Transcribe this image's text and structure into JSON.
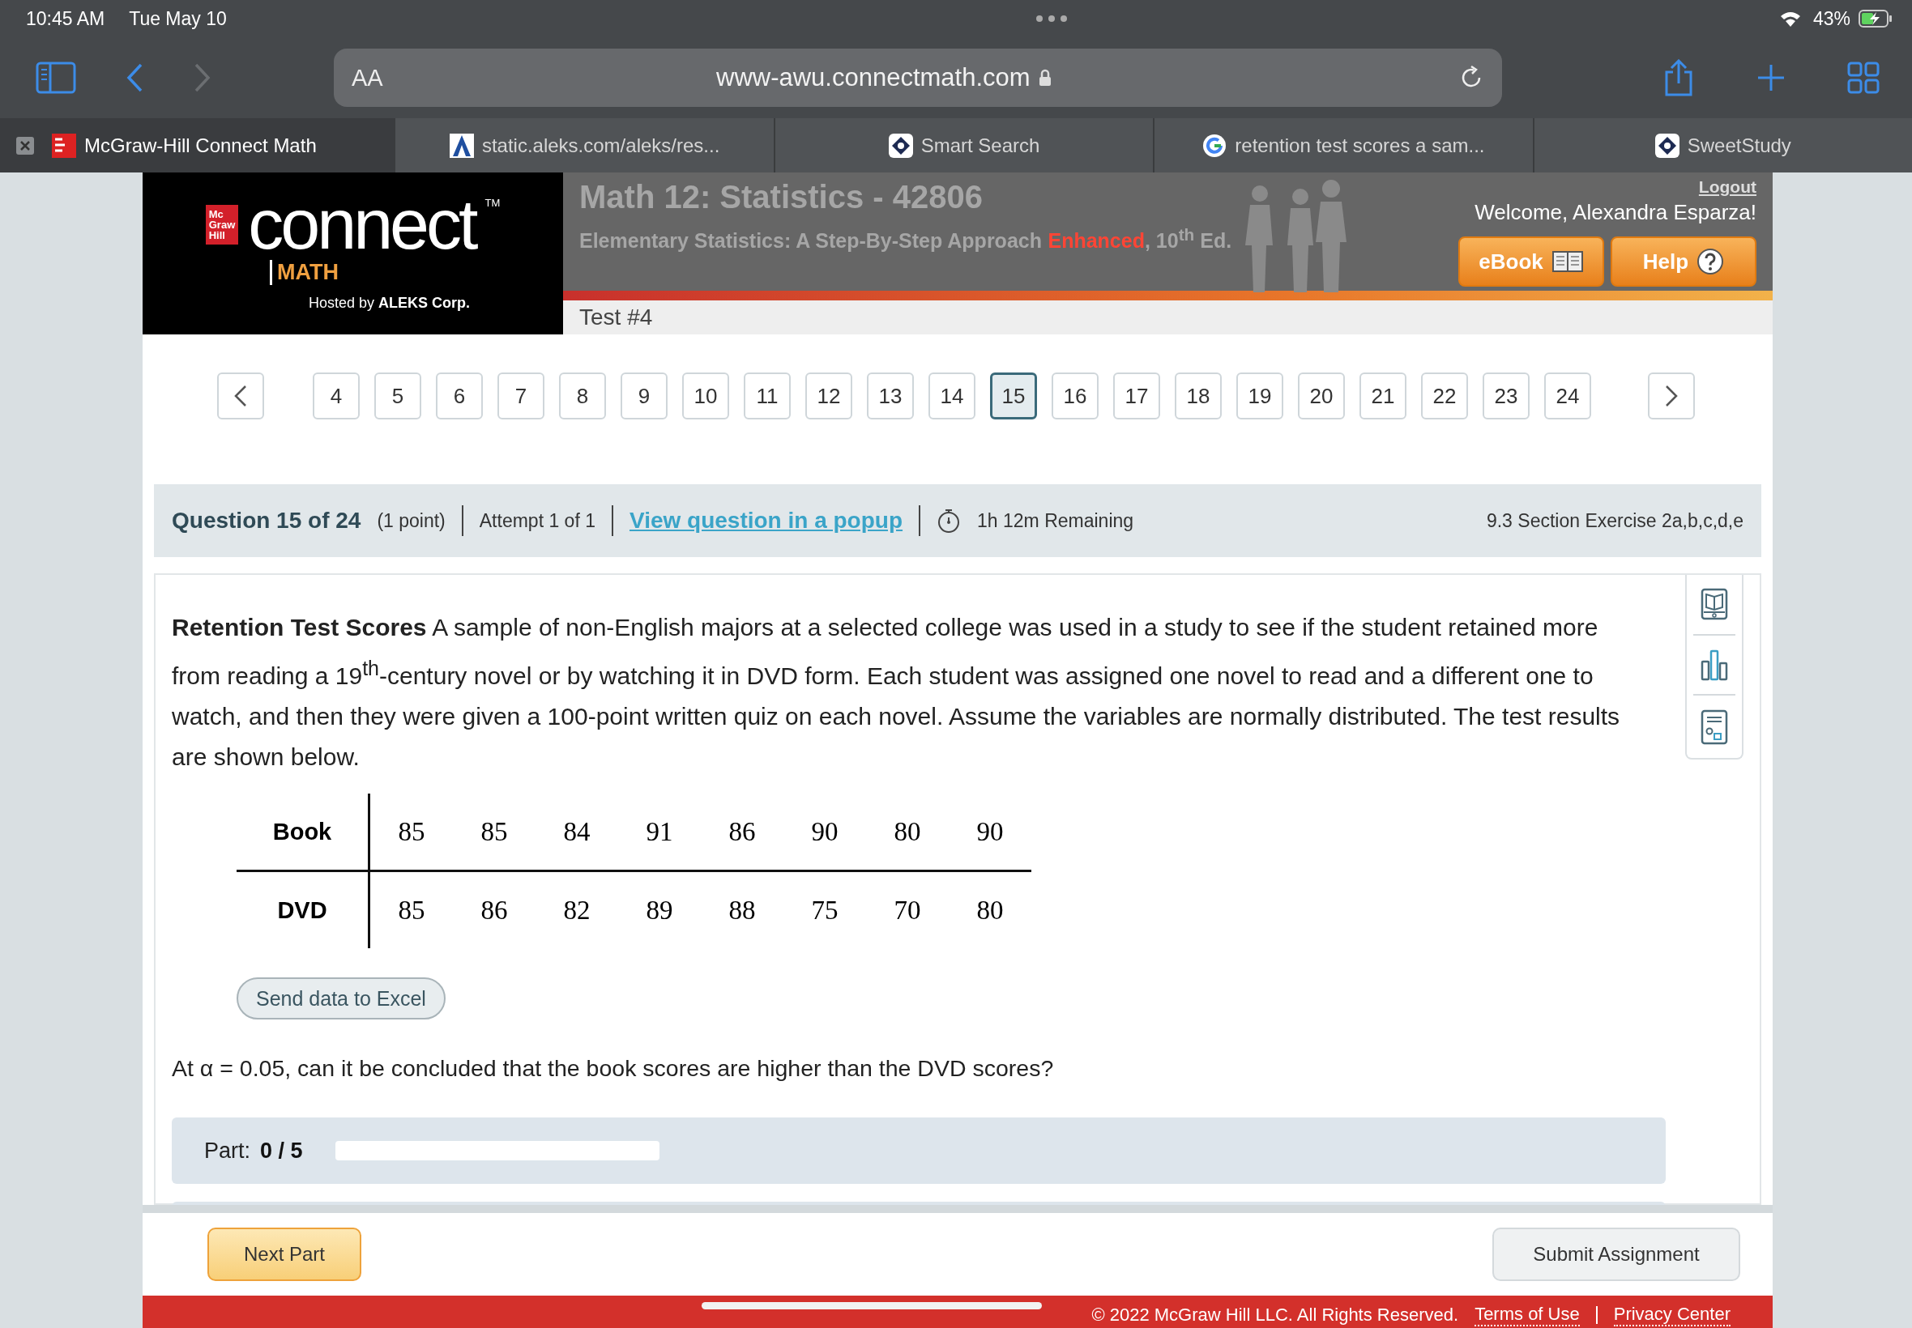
{
  "status_bar": {
    "time": "10:45 AM",
    "date": "Tue May 10",
    "battery": "43%"
  },
  "browser": {
    "text_size_button": "AA",
    "url": "www-awu.connectmath.com",
    "tabs": [
      {
        "label": "McGraw-Hill Connect Math",
        "selected": true,
        "kind": "mcgraw"
      },
      {
        "label": "static.aleks.com/aleks/res...",
        "selected": false,
        "kind": "aleks"
      },
      {
        "label": "Smart Search",
        "selected": false,
        "kind": "diamond"
      },
      {
        "label": "retention test scores a sam...",
        "selected": false,
        "kind": "google"
      },
      {
        "label": "SweetStudy",
        "selected": false,
        "kind": "diamond"
      }
    ]
  },
  "header": {
    "logo": {
      "badge": [
        "Mc",
        "Graw",
        "Hill"
      ],
      "wordmark": "connect",
      "trademark": "TM",
      "product": "MATH",
      "hosted": "Hosted by **ALEKS Corp.**"
    },
    "course_title": "Math 12: Statistics - 42806",
    "subtitle": {
      "book": "Elementary Statistics: A Step-By-Step Approach",
      "highlight": "Enhanced",
      "edition": ", 10$^{th}$ Ed."
    },
    "logout": "Logout",
    "welcome": "Welcome, Alexandra Esparza!",
    "ebook_button": "eBook",
    "help_button": "Help",
    "test_label": "Test #4"
  },
  "pagination": {
    "pages": [
      {
        "label": "4",
        "selected": false
      },
      {
        "label": "5",
        "selected": false
      },
      {
        "label": "6",
        "selected": false
      },
      {
        "label": "7",
        "selected": false
      },
      {
        "label": "8",
        "selected": false
      },
      {
        "label": "9",
        "selected": false
      },
      {
        "label": "10",
        "selected": false
      },
      {
        "label": "11",
        "selected": false
      },
      {
        "label": "12",
        "selected": false
      },
      {
        "label": "13",
        "selected": false
      },
      {
        "label": "14",
        "selected": false
      },
      {
        "label": "15",
        "selected": true
      },
      {
        "label": "16",
        "selected": false
      },
      {
        "label": "17",
        "selected": false
      },
      {
        "label": "18",
        "selected": false
      },
      {
        "label": "19",
        "selected": false
      },
      {
        "label": "20",
        "selected": false
      },
      {
        "label": "21",
        "selected": false
      },
      {
        "label": "22",
        "selected": false
      },
      {
        "label": "23",
        "selected": false
      },
      {
        "label": "24",
        "selected": false
      }
    ]
  },
  "question_bar": {
    "title": "Question 15 of 24",
    "points": "(1 point)",
    "attempt": "Attempt 1 of 1",
    "popup_link": "View question in a popup",
    "timer": "1h 12m Remaining",
    "section": "9.3 Section Exercise 2a,b,c,d,e"
  },
  "problem": {
    "intro": "**Retention Test Scores** A sample of non-English majors at a selected college was used in a study to see if the student retained more from reading a 19$^{th}$-century novel or by watching it in DVD form. Each student was assigned one novel to read and a different one to watch, and then they were given a 100-point written quiz on each novel. Assume the variables are normally distributed. The test results are shown below.",
    "table": {
      "rows": [
        {
          "label": "Book",
          "values": [
            "85",
            "85",
            "84",
            "91",
            "86",
            "90",
            "80",
            "90"
          ]
        },
        {
          "label": "DVD",
          "values": [
            "85",
            "86",
            "82",
            "89",
            "88",
            "75",
            "70",
            "80"
          ]
        }
      ]
    },
    "excel_button": "Send data to Excel",
    "question": "At α = 0.05, can it be concluded that the book scores are higher than the DVD scores?",
    "part": {
      "label": "Part:",
      "value": "0 / 5",
      "level": 0
    }
  },
  "footer": {
    "next_button": "Next Part",
    "submit_button": "Submit Assignment",
    "copyright": "© 2022 McGraw Hill LLC. All Rights Reserved.",
    "links": [
      "Terms of Use",
      "Privacy Center"
    ]
  }
}
